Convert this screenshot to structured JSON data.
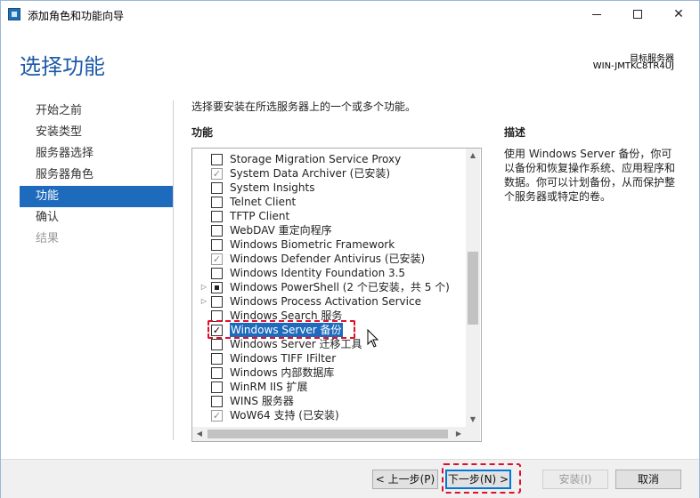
{
  "window": {
    "title": "添加角色和功能向导",
    "icon": "server-manager-icon"
  },
  "header": {
    "page_title": "选择功能",
    "target_label": "目标服务器",
    "target_server": "WIN-JMTKC8TR4UJ"
  },
  "nav": {
    "items": [
      {
        "label": "开始之前",
        "state": "normal"
      },
      {
        "label": "安装类型",
        "state": "normal"
      },
      {
        "label": "服务器选择",
        "state": "normal"
      },
      {
        "label": "服务器角色",
        "state": "normal"
      },
      {
        "label": "功能",
        "state": "active"
      },
      {
        "label": "确认",
        "state": "normal"
      },
      {
        "label": "结果",
        "state": "disabled"
      }
    ]
  },
  "content": {
    "instruction": "选择要安装在所选服务器上的一个或多个功能。",
    "features_header": "功能",
    "description_header": "描述",
    "description": "使用 Windows Server 备份，你可以备份和恢复操作系统、应用程序和数据。你可以计划备份，从而保护整个服务器或特定的卷。"
  },
  "features": [
    {
      "label": "Storage Migration Service Proxy",
      "check": "unchecked",
      "expander": false
    },
    {
      "label": "System Data Archiver (已安装)",
      "check": "installed",
      "expander": false
    },
    {
      "label": "System Insights",
      "check": "unchecked",
      "expander": false
    },
    {
      "label": "Telnet Client",
      "check": "unchecked",
      "expander": false
    },
    {
      "label": "TFTP Client",
      "check": "unchecked",
      "expander": false
    },
    {
      "label": "WebDAV 重定向程序",
      "check": "unchecked",
      "expander": false
    },
    {
      "label": "Windows Biometric Framework",
      "check": "unchecked",
      "expander": false
    },
    {
      "label": "Windows Defender Antivirus (已安装)",
      "check": "installed",
      "expander": false
    },
    {
      "label": "Windows Identity Foundation 3.5",
      "check": "unchecked",
      "expander": false
    },
    {
      "label": "Windows PowerShell (2 个已安装，共 5 个)",
      "check": "partial",
      "expander": true
    },
    {
      "label": "Windows Process Activation Service",
      "check": "unchecked",
      "expander": true
    },
    {
      "label": "Windows Search 服务",
      "check": "unchecked",
      "expander": false
    },
    {
      "label": "Windows Server 备份",
      "check": "checked",
      "expander": false,
      "selected": true
    },
    {
      "label": "Windows Server 迁移工具",
      "check": "unchecked",
      "expander": false
    },
    {
      "label": "Windows TIFF IFilter",
      "check": "unchecked",
      "expander": false
    },
    {
      "label": "Windows 内部数据库",
      "check": "unchecked",
      "expander": false
    },
    {
      "label": "WinRM IIS 扩展",
      "check": "unchecked",
      "expander": false
    },
    {
      "label": "WINS 服务器",
      "check": "unchecked",
      "expander": false
    },
    {
      "label": "WoW64 支持 (已安装)",
      "check": "installed",
      "expander": false
    }
  ],
  "footer": {
    "prev_label": "< 上一步(P)",
    "next_label": "下一步(N) >",
    "install_label": "安装(I)",
    "cancel_label": "取消"
  },
  "colors": {
    "accent": "#1e6bbd",
    "title_blue": "#1e5aa8",
    "annotation_red": "#e0102a"
  }
}
